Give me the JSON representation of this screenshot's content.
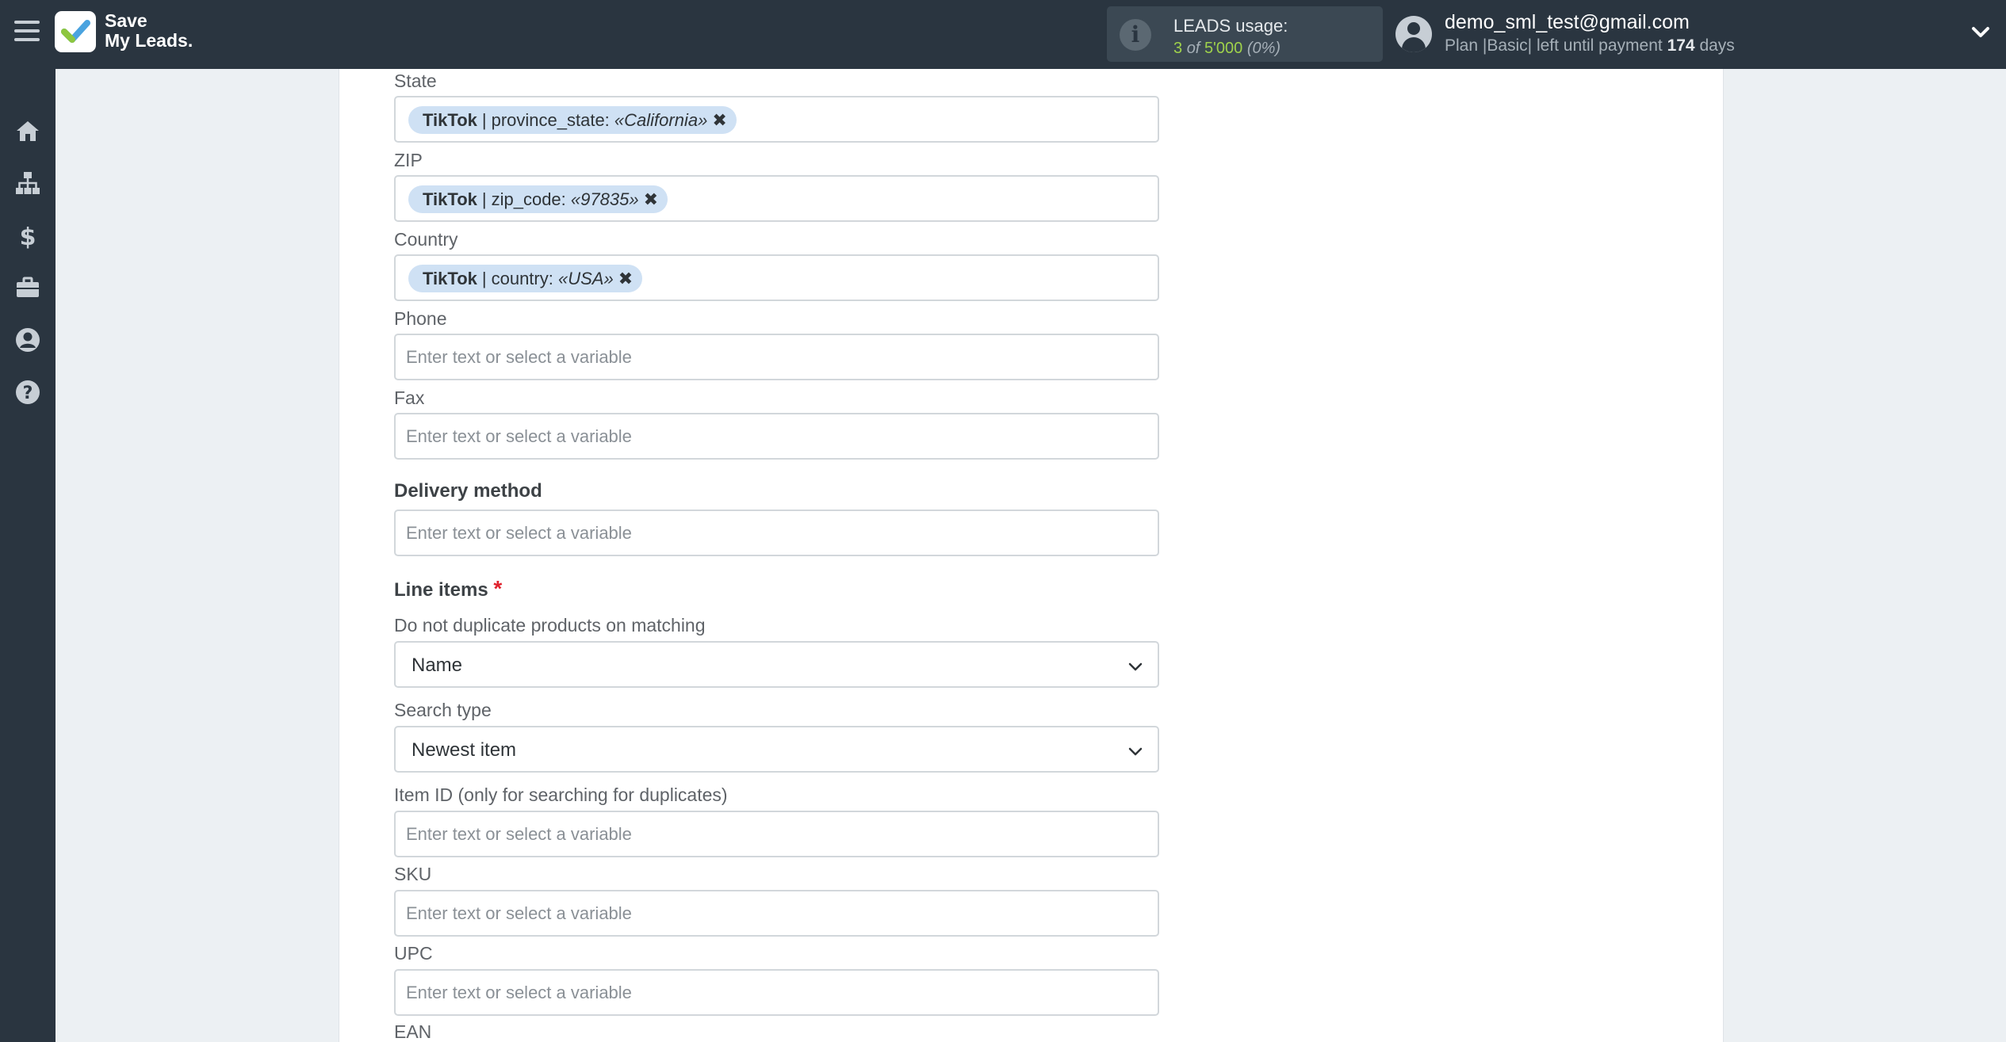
{
  "header": {
    "logo_line1": "Save",
    "logo_line2": "My Leads.",
    "usage_title": "LEADS usage:",
    "usage_used": "3",
    "usage_of": "of",
    "usage_total": "5'000",
    "usage_percent": "(0%)",
    "user_email": "demo_sml_test@gmail.com",
    "plan_prefix": "Plan |Basic| left until payment",
    "plan_days": "174",
    "plan_suffix": "days"
  },
  "sidebar": {
    "items": [
      {
        "icon": "home-icon"
      },
      {
        "icon": "sitemap-icon"
      },
      {
        "icon": "dollar-icon"
      },
      {
        "icon": "briefcase-icon"
      },
      {
        "icon": "user-icon"
      },
      {
        "icon": "question-icon"
      }
    ]
  },
  "form": {
    "placeholder": "Enter text or select a variable",
    "state": {
      "label": "State",
      "tag_source": "TikTok",
      "tag_sep": "|",
      "tag_field": "province_state:",
      "tag_value": "«California»",
      "tag_remove": "✖"
    },
    "zip": {
      "label": "ZIP",
      "tag_source": "TikTok",
      "tag_sep": "|",
      "tag_field": "zip_code:",
      "tag_value": "«97835»",
      "tag_remove": "✖"
    },
    "country": {
      "label": "Country",
      "tag_source": "TikTok",
      "tag_sep": "|",
      "tag_field": "country:",
      "tag_value": "«USA»",
      "tag_remove": "✖"
    },
    "phone": {
      "label": "Phone"
    },
    "fax": {
      "label": "Fax"
    },
    "delivery_method": {
      "label": "Delivery method"
    },
    "line_items": {
      "label": "Line items",
      "required_mark": "*"
    },
    "no_duplicate": {
      "label": "Do not duplicate products on matching",
      "value": "Name"
    },
    "search_type": {
      "label": "Search type",
      "value": "Newest item"
    },
    "item_id": {
      "label": "Item ID (only for searching for duplicates)"
    },
    "sku": {
      "label": "SKU"
    },
    "upc": {
      "label": "UPC"
    },
    "ean": {
      "label": "EAN"
    }
  },
  "colors": {
    "header_bg": "#2a3540",
    "tag_bg": "#cfe1f4",
    "usage_accent": "#9fd24b",
    "required": "#e0222d"
  }
}
